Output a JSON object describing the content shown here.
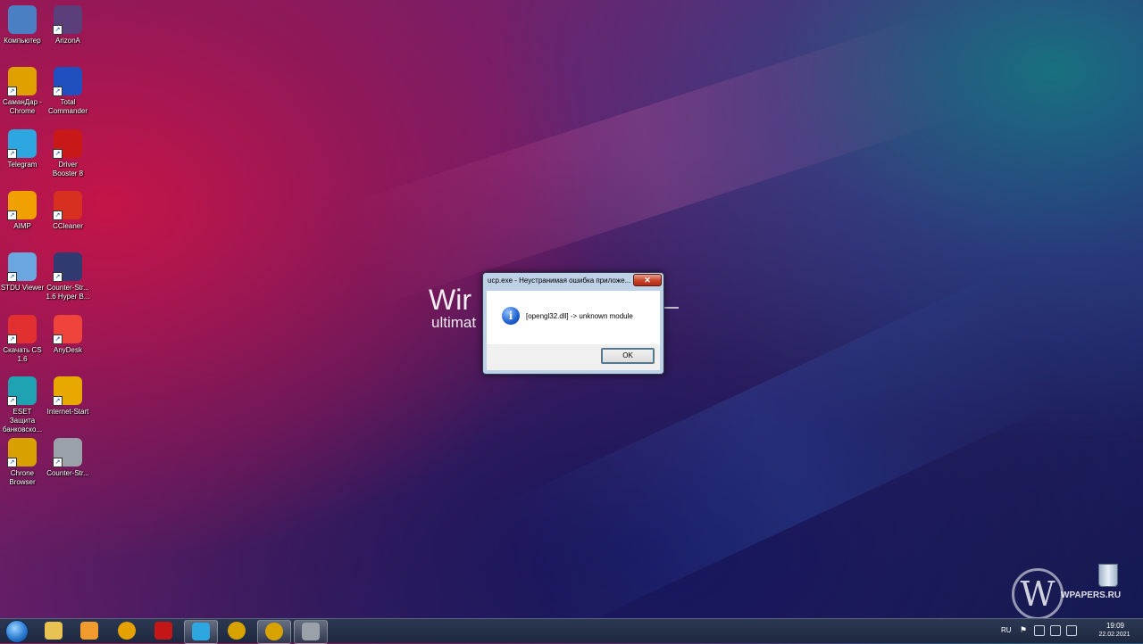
{
  "desktop": {
    "icons": [
      {
        "label": "Компьютер",
        "icon": "computer-icon",
        "color": "#4a7fc4"
      },
      {
        "label": "ArizonA",
        "icon": "arizona-icon",
        "color": "#5a3f7a"
      },
      {
        "label": "СаманДар - Chrome",
        "icon": "chrome-icon",
        "color": "#e0a000"
      },
      {
        "label": "Total Commander",
        "icon": "total-commander-icon",
        "color": "#2050c0"
      },
      {
        "label": "Telegram",
        "icon": "telegram-icon",
        "color": "#2ea6df"
      },
      {
        "label": "Driver Booster 8",
        "icon": "driver-booster-icon",
        "color": "#c81818"
      },
      {
        "label": "AIMP",
        "icon": "aimp-icon",
        "color": "#f0a000"
      },
      {
        "label": "CCleaner",
        "icon": "ccleaner-icon",
        "color": "#d83020"
      },
      {
        "label": "STDU Viewer",
        "icon": "stdu-viewer-icon",
        "color": "#6aa6e0"
      },
      {
        "label": "Counter-Str... 1.6 Hyper B...",
        "icon": "counter-strike-icon",
        "color": "#303a70"
      },
      {
        "label": "Скачать CS 1.6",
        "icon": "download-cs-icon",
        "color": "#e23030"
      },
      {
        "label": "AnyDesk",
        "icon": "anydesk-icon",
        "color": "#ef443b"
      },
      {
        "label": "ESET Защита банковско...",
        "icon": "eset-icon",
        "color": "#1fa3b2"
      },
      {
        "label": "Internet-Start",
        "icon": "internet-start-icon",
        "color": "#e8a800"
      },
      {
        "label": "Chrone Browser",
        "icon": "chrone-browser-icon",
        "color": "#d9a100"
      },
      {
        "label": "Counter-Str...",
        "icon": "counter-strike-2-icon",
        "color": "#9aa1a8"
      }
    ]
  },
  "wallpaper": {
    "title": "Wir",
    "subtitle": "ultimat"
  },
  "dialog": {
    "title": "ucp.exe - Неустранимая ошибка приложе...",
    "close_glyph": "✕",
    "icon": "info-icon",
    "icon_glyph": "i",
    "message": "[opengl32.dll] -> unknown module",
    "ok_label": "OK"
  },
  "watermark": {
    "logo_glyph": "W",
    "text": "WPAPERS.RU"
  },
  "taskbar": {
    "items": [
      {
        "icon": "explorer-icon",
        "color": "#e8c352"
      },
      {
        "icon": "media-player-icon",
        "color": "#f29b2e"
      },
      {
        "icon": "chrome-icon",
        "color": "#e5a100"
      },
      {
        "icon": "driver-booster-icon",
        "color": "#c41616"
      },
      {
        "icon": "telegram-icon",
        "color": "#2ea6df"
      },
      {
        "icon": "chrome-icon",
        "color": "#d8a300"
      },
      {
        "icon": "chrome-icon",
        "color": "#d8a300"
      },
      {
        "icon": "counter-strike-icon",
        "color": "#9aa1a8"
      }
    ],
    "tray": {
      "language": "RU",
      "time": "19:09",
      "date": "22.02.2021"
    }
  }
}
